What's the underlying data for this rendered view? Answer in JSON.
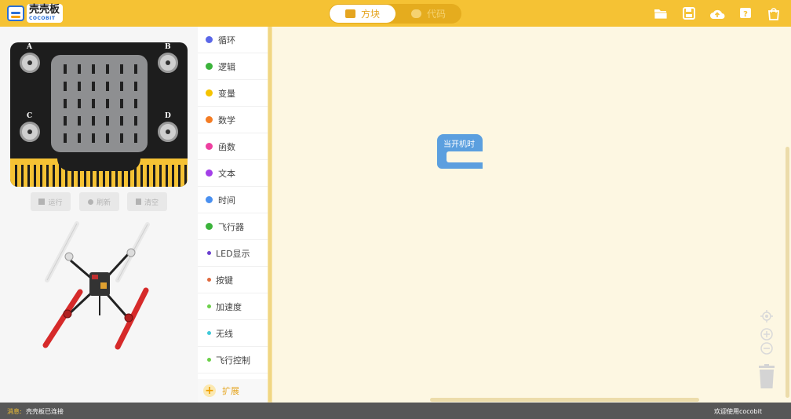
{
  "app": {
    "logo_text": "壳壳板",
    "logo_subtext": "COCOBIT"
  },
  "header": {
    "tabs": [
      {
        "label": "方块",
        "active": true,
        "icon": "puzzle-icon"
      },
      {
        "label": "代码",
        "active": false,
        "icon": "code-icon"
      }
    ],
    "actions": [
      {
        "name": "open-folder-icon"
      },
      {
        "name": "save-icon"
      },
      {
        "name": "cloud-upload-icon"
      },
      {
        "name": "help-icon"
      },
      {
        "name": "shopping-bag-icon"
      }
    ],
    "colors": {
      "bar": "#f5c234",
      "active_tab_text": "#e5a520"
    }
  },
  "device": {
    "buttons": {
      "a": "A",
      "b": "B",
      "c": "C",
      "d": "D"
    },
    "controls": [
      {
        "label": "运行",
        "icon": "stop-icon"
      },
      {
        "label": "刷新",
        "icon": "refresh-icon"
      },
      {
        "label": "清空",
        "icon": "trash-icon"
      }
    ]
  },
  "categories": [
    {
      "label": "循环",
      "color": "#5b67e8"
    },
    {
      "label": "逻辑",
      "color": "#3bb33b"
    },
    {
      "label": "变量",
      "color": "#f5c300"
    },
    {
      "label": "数学",
      "color": "#f47c23"
    },
    {
      "label": "函数",
      "color": "#ee3fa0"
    },
    {
      "label": "文本",
      "color": "#a33fe8"
    },
    {
      "label": "时间",
      "color": "#4a90f0"
    },
    {
      "label": "飞行器",
      "color": "#3bb33b"
    },
    {
      "label": "LED显示",
      "color": "#6a3fd0"
    },
    {
      "label": "按键",
      "color": "#e06a3f"
    },
    {
      "label": "加速度",
      "color": "#6cd04a"
    },
    {
      "label": "无线",
      "color": "#3fc9d9"
    },
    {
      "label": "飞行控制",
      "color": "#6cd04a"
    }
  ],
  "extension": {
    "label": "扩展"
  },
  "workspace": {
    "hat_block_label": "当开机时",
    "zoom_controls": [
      "recenter-icon",
      "zoom-in-icon",
      "zoom-out-icon"
    ]
  },
  "status": {
    "label": "消息:",
    "message": "壳壳板已连接",
    "welcome": "欢迎使用cocobit"
  }
}
